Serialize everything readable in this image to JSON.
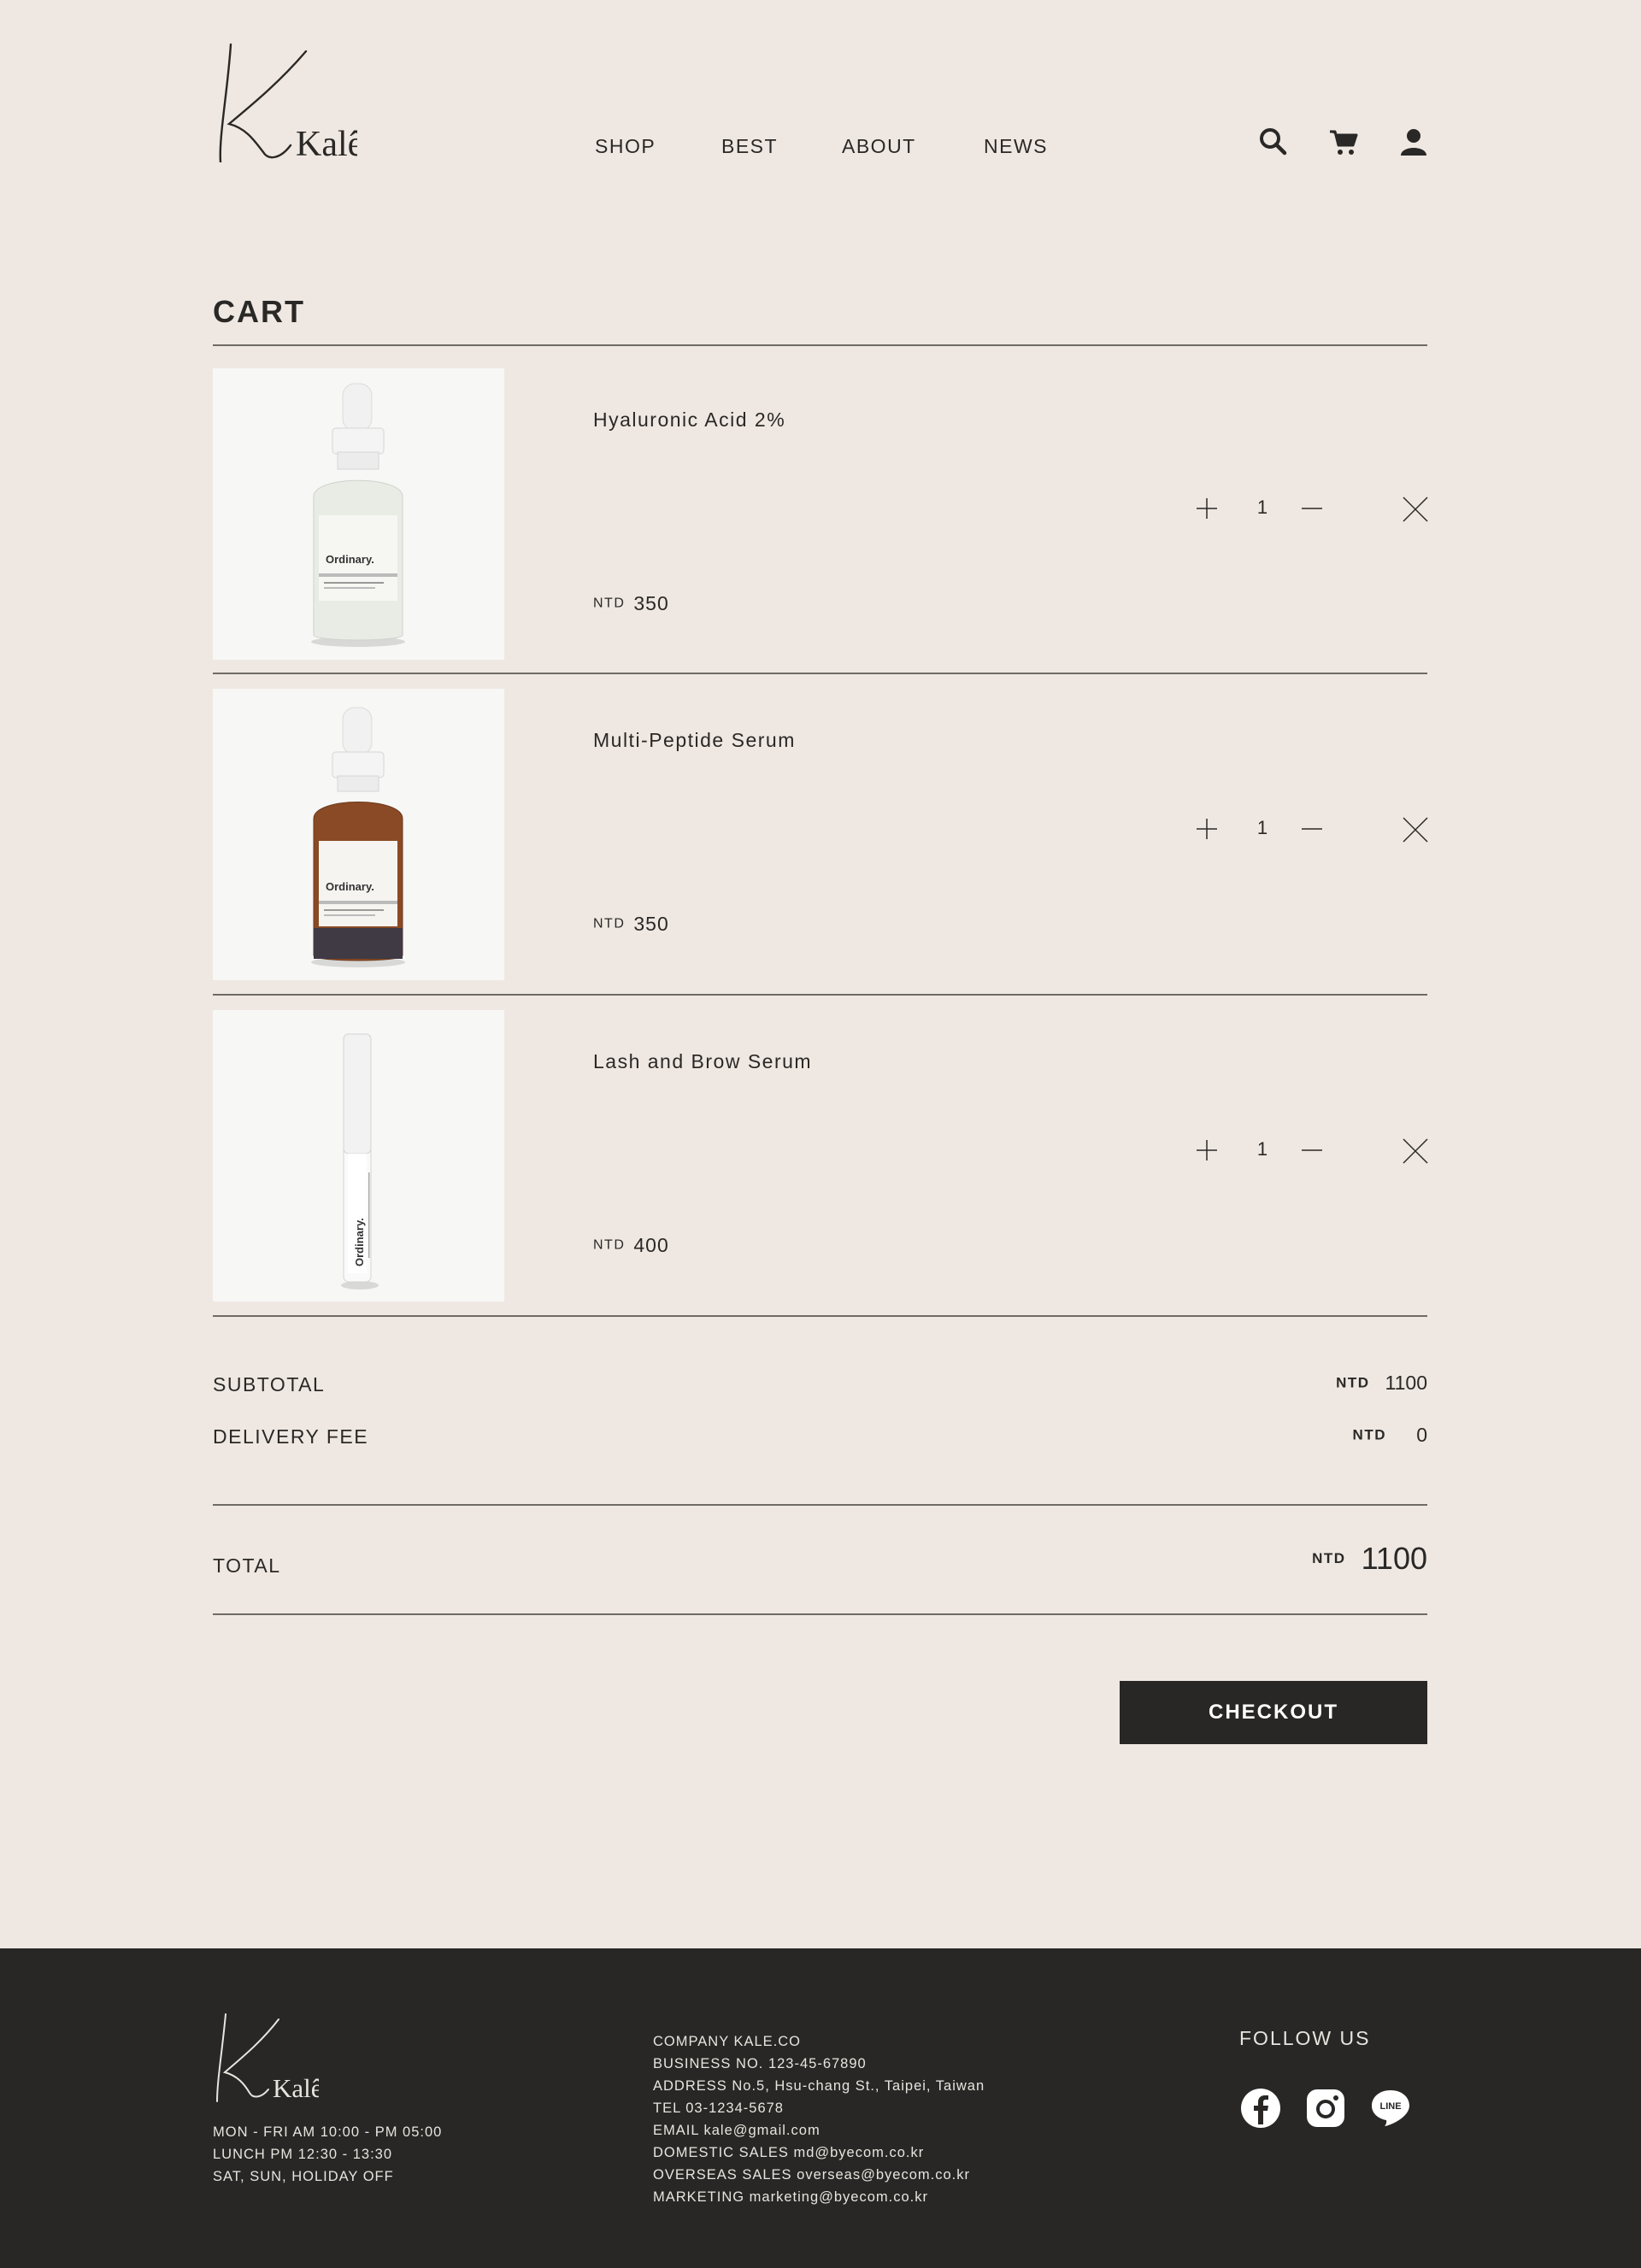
{
  "header": {
    "logo_text": "Kalê",
    "nav": [
      "SHOP",
      "BEST",
      "ABOUT",
      "NEWS"
    ]
  },
  "cart": {
    "title": "CART",
    "items": [
      {
        "name": "Hyaluronic Acid 2%",
        "currency": "NTD",
        "price": "350",
        "qty": "1",
        "bottle": "frosted"
      },
      {
        "name": "Multi-Peptide Serum",
        "currency": "NTD",
        "price": "350",
        "qty": "1",
        "bottle": "amber"
      },
      {
        "name": "Lash and Brow Serum",
        "currency": "NTD",
        "price": "400",
        "qty": "1",
        "bottle": "tube"
      }
    ]
  },
  "summary": {
    "subtotal_label": "SUBTOTAL",
    "subtotal_currency": "NTD",
    "subtotal_value": "1100",
    "delivery_label": "DELIVERY FEE",
    "delivery_currency": "NTD",
    "delivery_value": "0",
    "total_label": "TOTAL",
    "total_currency": "NTD",
    "total_value": "1100"
  },
  "checkout_label": "CHECKOUT",
  "footer": {
    "hours": [
      "MON - FRI AM 10:00 - PM 05:00",
      "LUNCH PM 12:30 - 13:30",
      "SAT, SUN, HOLIDAY OFF"
    ],
    "company": [
      "COMPANY KALE.CO",
      "BUSINESS NO. 123-45-67890",
      "ADDRESS No.5, Hsu-chang St., Taipei, Taiwan",
      "TEL 03-1234-5678",
      "EMAIL kale@gmail.com",
      "DOMESTIC SALES md@byecom.co.kr",
      "OVERSEAS SALES overseas@byecom.co.kr",
      "MARKETING marketing@byecom.co.kr"
    ],
    "follow_label": "FOLLOW US",
    "social": [
      "facebook-icon",
      "instagram-icon",
      "line-icon"
    ]
  },
  "colors": {
    "background": "#efe8e2",
    "text": "#2a2826",
    "footer_bg": "#282725",
    "button_bg": "#282725"
  }
}
